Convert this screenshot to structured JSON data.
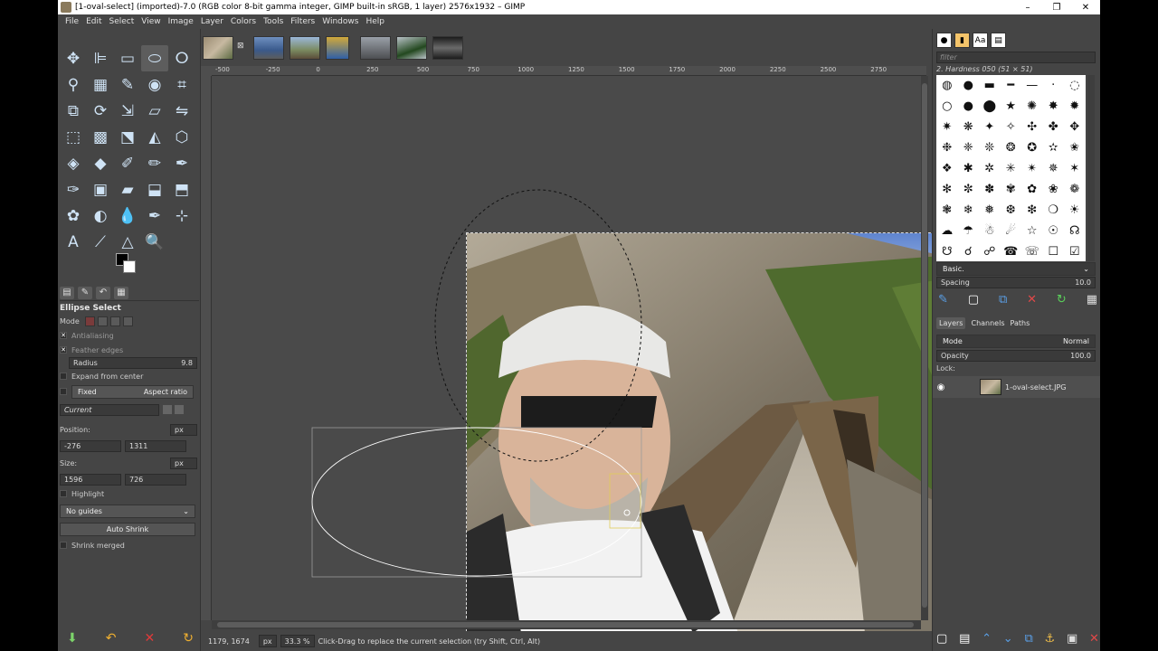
{
  "window": {
    "title": "[1-oval-select] (imported)-7.0 (RGB color 8-bit gamma integer, GIMP built-in sRGB, 1 layer) 2576x1932 – GIMP",
    "controls": {
      "minimize": "–",
      "maximize": "❐",
      "close": "✕"
    }
  },
  "menu": [
    "File",
    "Edit",
    "Select",
    "View",
    "Image",
    "Layer",
    "Colors",
    "Tools",
    "Filters",
    "Windows",
    "Help"
  ],
  "toolbox": {
    "tools": [
      {
        "name": "move-tool",
        "glyph": "✥"
      },
      {
        "name": "align-tool",
        "glyph": "⊫"
      },
      {
        "name": "rect-select-tool",
        "glyph": "▭"
      },
      {
        "name": "ellipse-select-tool",
        "glyph": "⬭",
        "active": true
      },
      {
        "name": "free-select-tool",
        "glyph": "ⵔ"
      },
      {
        "name": "fuzzy-select-tool",
        "glyph": "⚲"
      },
      {
        "name": "by-color-select-tool",
        "glyph": "▦"
      },
      {
        "name": "scissors-select-tool",
        "glyph": "✎"
      },
      {
        "name": "foreground-select-tool",
        "glyph": "◉"
      },
      {
        "name": "crop-tool",
        "glyph": "⌗"
      },
      {
        "name": "unified-transform-tool",
        "glyph": "⧉"
      },
      {
        "name": "rotate-tool",
        "glyph": "⟳"
      },
      {
        "name": "scale-tool",
        "glyph": "⇲"
      },
      {
        "name": "shear-tool",
        "glyph": "▱"
      },
      {
        "name": "flip-tool",
        "glyph": "⇋"
      },
      {
        "name": "perspective-tool",
        "glyph": "⬚"
      },
      {
        "name": "3d-transform-tool",
        "glyph": "▩"
      },
      {
        "name": "handle-transform-tool",
        "glyph": "⬔"
      },
      {
        "name": "warp-transform-tool",
        "glyph": "◭"
      },
      {
        "name": "cage-transform-tool",
        "glyph": "⬡"
      },
      {
        "name": "bucket-fill-tool",
        "glyph": "◈"
      },
      {
        "name": "gradient-tool",
        "glyph": "◆"
      },
      {
        "name": "paintbrush-tool",
        "glyph": "✐"
      },
      {
        "name": "pencil-tool",
        "glyph": "✏"
      },
      {
        "name": "color-picker-tool",
        "glyph": "✒"
      },
      {
        "name": "airbrush-tool",
        "glyph": "✑"
      },
      {
        "name": "mypaint-brush-tool",
        "glyph": "▣"
      },
      {
        "name": "eraser-tool",
        "glyph": "▰"
      },
      {
        "name": "clone-tool",
        "glyph": "⬓"
      },
      {
        "name": "heal-tool",
        "glyph": "⬒"
      },
      {
        "name": "smudge-tool",
        "glyph": "✿"
      },
      {
        "name": "dodge-burn-tool",
        "glyph": "◐"
      },
      {
        "name": "blur-tool",
        "glyph": "💧"
      },
      {
        "name": "ink-tool",
        "glyph": "✒"
      },
      {
        "name": "measure-tool",
        "glyph": "⊹"
      },
      {
        "name": "text-tool",
        "glyph": "A"
      },
      {
        "name": "path-tool",
        "glyph": "⟋"
      },
      {
        "name": "warp-tool",
        "glyph": "△"
      },
      {
        "name": "zoom-tool",
        "glyph": "🔍"
      }
    ],
    "tab_icons": [
      "▤",
      "✎",
      "↶",
      "▦"
    ],
    "options": {
      "title": "Ellipse Select",
      "mode_label": "Mode",
      "antialiasing": "Antialiasing",
      "feather_edges": "Feather edges",
      "radius_label": "Radius",
      "radius_value": "9.8",
      "expand_from_center": "Expand from center",
      "fixed_label": "Fixed",
      "fixed_value": "Aspect ratio",
      "current_label": "Current",
      "position_label": "Position:",
      "position_unit": "px",
      "position_x": "-276",
      "position_y": "1311",
      "size_label": "Size:",
      "size_unit": "px",
      "size_w": "1596",
      "size_h": "726",
      "highlight": "Highlight",
      "guides_value": "No guides",
      "auto_shrink": "Auto Shrink",
      "shrink_merged": "Shrink merged"
    }
  },
  "ruler": {
    "h_labels": [
      "-500",
      "-250",
      "0",
      "250",
      "500",
      "750",
      "1000",
      "1250",
      "1500",
      "1750",
      "2000",
      "2250",
      "2500",
      "2750"
    ]
  },
  "statusbar": {
    "coords": "1179, 1674",
    "unit": "px",
    "zoom": "33.3 %",
    "message": "Click-Drag to replace the current selection (try Shift, Ctrl, Alt)"
  },
  "colors": {
    "bg": "#454545",
    "accent": "#cfe3f5",
    "photo_sky": "#6b8fd1",
    "photo_rock": "#9c9486",
    "photo_forest": "#4b6b2c"
  },
  "rightdock": {
    "brush_tabs": [
      "●",
      "▮",
      "Aa",
      "▤"
    ],
    "filter_placeholder": "filter",
    "brush_name": "2. Hardness 050 (51 × 51)",
    "brush_glyphs": [
      "◍",
      "●",
      "▬",
      "━",
      "—",
      "·",
      "◌",
      "○",
      "●",
      "⬤",
      "★",
      "✺",
      "✸",
      "✹",
      "✷",
      "❋",
      "✦",
      "✧",
      "✣",
      "✤",
      "✥",
      "❉",
      "❈",
      "❊",
      "❂",
      "✪",
      "✫",
      "✬",
      "❖",
      "✱",
      "✲",
      "✳",
      "✴",
      "✵",
      "✶",
      "✻",
      "✼",
      "✽",
      "✾",
      "✿",
      "❀",
      "❁",
      "❃",
      "❄",
      "❅",
      "❆",
      "❇",
      "❍",
      "☀",
      "☁",
      "☂",
      "☃",
      "☄",
      "☆",
      "☉",
      "☊",
      "☋",
      "☌",
      "☍",
      "☎",
      "☏",
      "☐",
      "☑"
    ],
    "preset_value": "Basic.",
    "spacing_label": "Spacing",
    "spacing_value": "10.0",
    "layers_tabs": [
      "Layers",
      "Channels",
      "Paths"
    ],
    "mode_label": "Mode",
    "mode_value": "Normal",
    "opacity_label": "Opacity",
    "opacity_value": "100.0",
    "lock_label": "Lock:",
    "layer_name": "1-oval-select.JPG"
  }
}
